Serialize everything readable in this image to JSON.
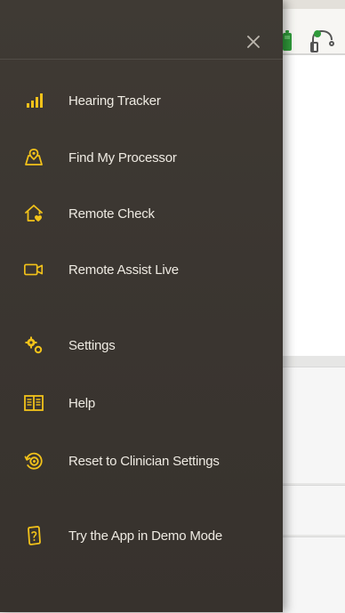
{
  "drawer": {
    "close_icon": "close-icon",
    "accent_color": "#f2c21a",
    "items": [
      {
        "label": "Hearing Tracker",
        "icon": "signal-bars-icon"
      },
      {
        "label": "Find My Processor",
        "icon": "map-pin-icon"
      },
      {
        "label": "Remote Check",
        "icon": "home-heart-icon"
      },
      {
        "label": "Remote Assist Live",
        "icon": "video-camera-icon"
      },
      {
        "label": "Settings",
        "icon": "gears-icon"
      },
      {
        "label": "Help",
        "icon": "book-icon"
      },
      {
        "label": "Reset to Clinician Settings",
        "icon": "reset-target-icon"
      },
      {
        "label": "Try the App in Demo Mode",
        "icon": "demo-phone-icon"
      }
    ]
  },
  "background": {
    "battery_color": "#2f9a3a",
    "icons": [
      "battery-icon",
      "processor-icon"
    ]
  }
}
